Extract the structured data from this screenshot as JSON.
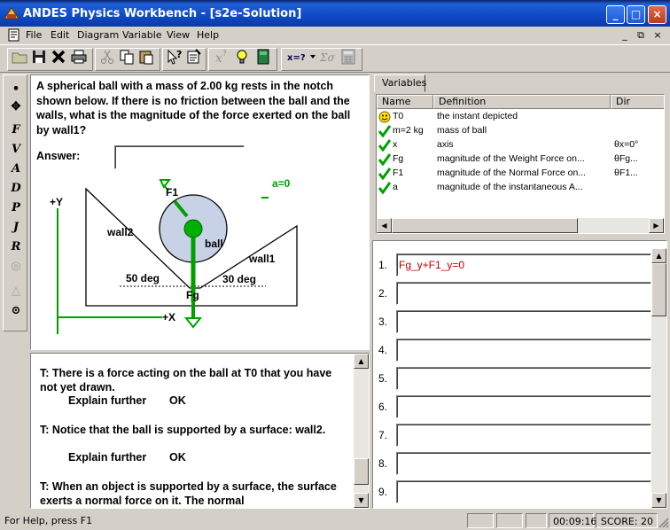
{
  "window": {
    "title": "ANDES Physics Workbench - [s2e-Solution]",
    "controls": {
      "minimize": "_",
      "maximize": "□",
      "close": "×"
    }
  },
  "menu": {
    "items": [
      "File",
      "Edit",
      "Diagram",
      "Variable",
      "View",
      "Help"
    ],
    "mdi_controls": [
      "_",
      "⧉",
      "×"
    ]
  },
  "toolbar": {
    "buttons": [
      "open-icon",
      "save-icon",
      "delete-icon",
      "print-icon",
      "cut-icon",
      "copy-icon",
      "paste-icon",
      "what-is-this-icon",
      "checklist-icon",
      "hint-x-icon",
      "lightbulb-hint-icon",
      "book-icon",
      "solve-for-icon",
      "sum-icon",
      "calculator-icon"
    ],
    "solve_label": "x=?",
    "sigma_label": "Σσ"
  },
  "left_tools": [
    "•",
    "✥",
    "F",
    "V",
    "A",
    "D",
    "P",
    "J",
    "R",
    "◎",
    "△",
    "⊙"
  ],
  "problem": {
    "statement": "A spherical ball with a mass of 2.00 kg rests in the notch shown below.  If there is no friction between the ball and the walls, what is the magnitude of the force exerted on the ball by wall1?",
    "answer_label": "Answer:",
    "answer_value": "",
    "diagram": {
      "labels": {
        "f1": "F1",
        "accel": "a=0",
        "wall2": "wall2",
        "ball": "ball",
        "wall1": "wall1",
        "angle_left": "50 deg",
        "angle_right": "30 deg",
        "fg": "Fg",
        "y_axis": "+Y",
        "x_axis": "+X"
      }
    }
  },
  "tutor": {
    "messages": [
      {
        "text": "T: There is a force acting on the ball at T0 that you have not yet drawn.",
        "explain": "Explain further",
        "ok": "OK"
      },
      {
        "text": "T: Notice that the ball is supported by a surface: wall2.",
        "explain": "Explain further",
        "ok": "OK"
      },
      {
        "text": "T: When an object is supported by a surface, the surface exerts a normal force on it.  The normal"
      }
    ]
  },
  "variables": {
    "tab_label": "Variables",
    "columns": [
      "Name",
      "Definition",
      "Dir"
    ],
    "rows": [
      {
        "status": "smiley-icon",
        "name": "T0",
        "definition": "the instant depicted",
        "dir": ""
      },
      {
        "status": "check-icon",
        "name": "m=2 kg",
        "definition": "mass of ball",
        "dir": ""
      },
      {
        "status": "check-icon",
        "name": "x",
        "definition": "axis",
        "dir": "θx=0°"
      },
      {
        "status": "check-icon",
        "name": "Fg",
        "definition": "magnitude of the Weight Force on...",
        "dir": "θFg..."
      },
      {
        "status": "check-icon",
        "name": "F1",
        "definition": "magnitude of the Normal Force on...",
        "dir": "θF1..."
      },
      {
        "status": "check-icon",
        "name": "a",
        "definition": "magnitude of the instantaneous A...",
        "dir": ""
      }
    ]
  },
  "equations": {
    "rows": [
      {
        "num": "1.",
        "value": "Fg_y+F1_y=0"
      },
      {
        "num": "2.",
        "value": ""
      },
      {
        "num": "3.",
        "value": ""
      },
      {
        "num": "4.",
        "value": ""
      },
      {
        "num": "5.",
        "value": ""
      },
      {
        "num": "6.",
        "value": ""
      },
      {
        "num": "7.",
        "value": ""
      },
      {
        "num": "8.",
        "value": ""
      },
      {
        "num": "9.",
        "value": ""
      }
    ]
  },
  "statusbar": {
    "help_text": "For Help, press F1",
    "time": "00:09:16",
    "score": "SCORE: 20"
  },
  "colors": {
    "title_blue": "#0f4ac6",
    "force_green": "#00a000",
    "equation_red": "#c00000",
    "ball_fill": "#c8d2e6"
  }
}
